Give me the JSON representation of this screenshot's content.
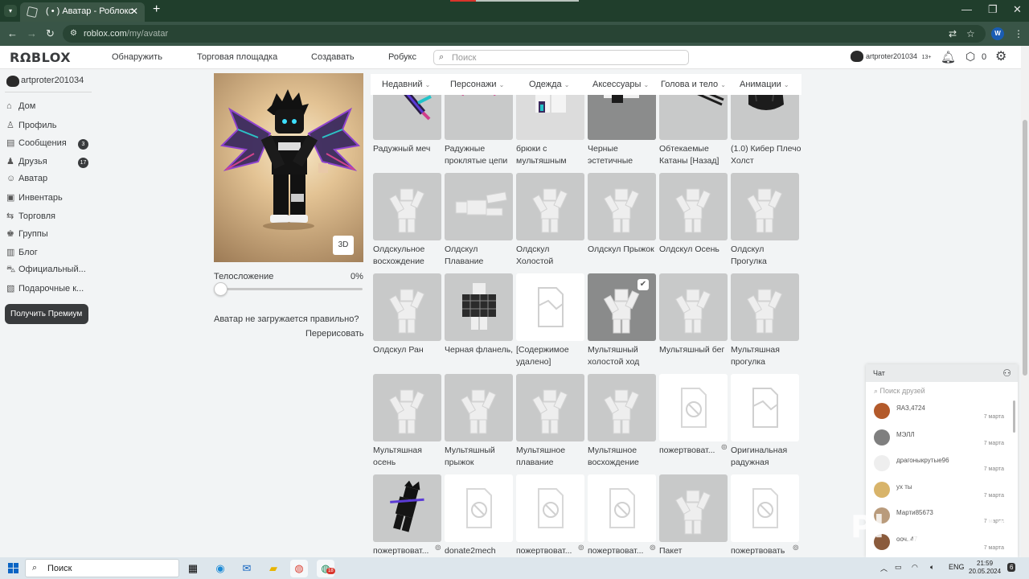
{
  "browser": {
    "tab_title": "( • ) Аватар - Роблокс",
    "url_host": "roblox.com",
    "url_path": "/my/avatar",
    "extension_letter": "W"
  },
  "header": {
    "logo": "RΩBLOX",
    "nav": [
      "Обнаружить",
      "Торговая площадка",
      "Создавать",
      "Робукс"
    ],
    "search_placeholder": "Поиск",
    "username": "artproter201034",
    "age_tag": "13+",
    "robux": "0"
  },
  "sidebar": {
    "username": "artproter201034",
    "items": [
      {
        "label": "Дом",
        "icon": "house-icon"
      },
      {
        "label": "Профиль",
        "icon": "profile-icon"
      },
      {
        "label": "Сообщения",
        "icon": "messages-icon",
        "badge": "3"
      },
      {
        "label": "Друзья",
        "icon": "friends-icon",
        "badge": "17"
      },
      {
        "label": "Аватар",
        "icon": "avatar-icon"
      },
      {
        "label": "Инвентарь",
        "icon": "inventory-icon"
      },
      {
        "label": "Торговля",
        "icon": "trade-icon"
      },
      {
        "label": "Группы",
        "icon": "groups-icon"
      },
      {
        "label": "Блог",
        "icon": "blog-icon"
      },
      {
        "label": "Официальный...",
        "icon": "store-icon"
      },
      {
        "label": "Подарочные к...",
        "icon": "giftcard-icon"
      }
    ],
    "premium_button": "Получить Премиум"
  },
  "avatar_panel": {
    "btn_3d": "3D",
    "body_label": "Телосложение",
    "body_value": "0%",
    "body_level": 0,
    "broken_question": "Аватар не загружается правильно?",
    "redraw": "Перерисовать"
  },
  "categories": [
    "Недавний",
    "Персонажи",
    "Одежда",
    "Аксессуары",
    "Голова и тело",
    "Анимации"
  ],
  "items": [
    {
      "name": "Радужный меч",
      "style": "sword"
    },
    {
      "name": "Радужные проклятые цепи",
      "style": "chains"
    },
    {
      "name": "брюки с мультяшным",
      "style": "pants"
    },
    {
      "name": "Черные эстетичные",
      "style": "shirt"
    },
    {
      "name": "Обтекаемые Катаны [Назад]",
      "style": "katana"
    },
    {
      "name": "(1.0) Кибер Плечо Холст",
      "style": "bag"
    },
    {
      "name": "Олдскульное восхождение",
      "style": "figure"
    },
    {
      "name": "Олдскул Плавание",
      "style": "figure-lying"
    },
    {
      "name": "Олдскул Холостой",
      "style": "figure"
    },
    {
      "name": "Олдскул Прыжок",
      "style": "figure"
    },
    {
      "name": "Олдскул Осень",
      "style": "figure"
    },
    {
      "name": "Олдскул Прогулка",
      "style": "figure"
    },
    {
      "name": "Олдскул Ран",
      "style": "figure"
    },
    {
      "name": "Черная фланель,",
      "style": "flannel"
    },
    {
      "name": "[Содержимое удалено]",
      "style": "removed"
    },
    {
      "name": "Мультяшный холостой ход",
      "style": "figure-selected",
      "selected": true
    },
    {
      "name": "Мультяшный бег",
      "style": "figure"
    },
    {
      "name": "Мультяшная прогулка",
      "style": "figure"
    },
    {
      "name": "Мультяшная осень",
      "style": "figure"
    },
    {
      "name": "Мультяшный прыжок",
      "style": "figure"
    },
    {
      "name": "Мультяшное плавание",
      "style": "figure"
    },
    {
      "name": "Мультяшное восхождение",
      "style": "figure"
    },
    {
      "name": "пожертвоват...",
      "style": "blocked",
      "limited": true
    },
    {
      "name": "Оригинальная радужная",
      "style": "removed"
    },
    {
      "name": "пожертвоват...",
      "style": "avatar-dark",
      "limited": true
    },
    {
      "name": "donate2mech",
      "style": "blocked"
    },
    {
      "name": "пожертвоват...",
      "style": "blocked",
      "limited": true
    },
    {
      "name": "пожертвоват...",
      "style": "blocked",
      "limited": true
    },
    {
      "name": "Пакет",
      "style": "figure"
    },
    {
      "name": "пожертвовать",
      "style": "blocked",
      "limited": true
    }
  ],
  "chat": {
    "title": "Чат",
    "search_placeholder": "Поиск друзей",
    "contacts": [
      {
        "name": "ЯАЗ,4724",
        "date": "7 марта",
        "avatar_color": "#b35a2b"
      },
      {
        "name": "МЭЛЛ",
        "date": "7 марта",
        "avatar_color": "#7f7f7f"
      },
      {
        "name": "драгоныкрутые96",
        "date": "7 марта",
        "avatar_color": "#eeeeee"
      },
      {
        "name": "ух ты",
        "date": "7 марта",
        "avatar_color": "#d8b46a"
      },
      {
        "name": "Марти85673",
        "date": "7 марта",
        "avatar_color": "#b99b7c"
      },
      {
        "name": "ооч..47",
        "date": "7 марта",
        "avatar_color": "#8a5b3c"
      }
    ]
  },
  "watermark": "Playerok",
  "taskbar": {
    "search": "Поиск",
    "lang": "ENG",
    "time": "21:59",
    "date": "20.05.2024",
    "notifications": "6",
    "chrome_badge": "18"
  }
}
